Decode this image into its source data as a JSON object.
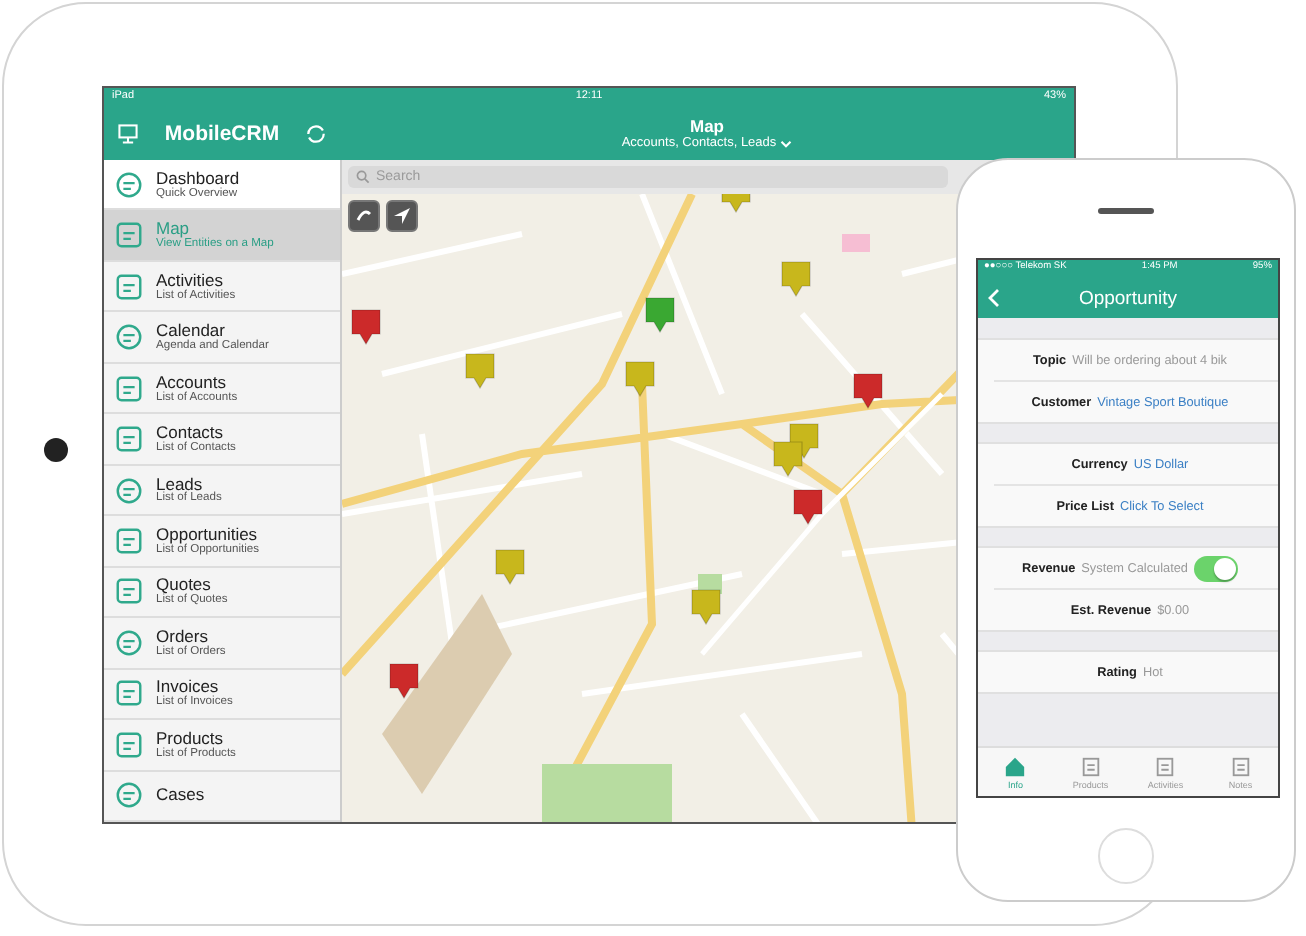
{
  "tablet": {
    "status_bar": {
      "device": "iPad",
      "time": "12:11",
      "battery": "43%"
    },
    "sidebar": {
      "title": "MobileCRM",
      "items": [
        {
          "title": "Dashboard",
          "subtitle": "Quick Overview",
          "selected": false
        },
        {
          "title": "Map",
          "subtitle": "View Entities on a Map",
          "selected": true
        },
        {
          "title": "Activities",
          "subtitle": "List of Activities",
          "selected": false
        },
        {
          "title": "Calendar",
          "subtitle": "Agenda and Calendar",
          "selected": false
        },
        {
          "title": "Accounts",
          "subtitle": "List of Accounts",
          "selected": false
        },
        {
          "title": "Contacts",
          "subtitle": "List of Contacts",
          "selected": false
        },
        {
          "title": "Leads",
          "subtitle": "List of Leads",
          "selected": false
        },
        {
          "title": "Opportunities",
          "subtitle": "List of Opportunities",
          "selected": false
        },
        {
          "title": "Quotes",
          "subtitle": "List of Quotes",
          "selected": false
        },
        {
          "title": "Orders",
          "subtitle": "List of Orders",
          "selected": false
        },
        {
          "title": "Invoices",
          "subtitle": "List of Invoices",
          "selected": false
        },
        {
          "title": "Products",
          "subtitle": "List of Products",
          "selected": false
        },
        {
          "title": "Cases",
          "selected": false
        }
      ]
    },
    "header": {
      "title": "Map",
      "subtitle": "Accounts, Contacts, Leads"
    },
    "search": {
      "placeholder": "Search"
    }
  },
  "phone": {
    "status_bar": {
      "carrier": "●●○○○ Telekom SK",
      "time": "1:45 PM",
      "battery": "95%"
    },
    "title": "Opportunity",
    "sections": [
      [
        {
          "label": "Topic",
          "value": "Will be ordering about 4 bik",
          "kind": "text"
        },
        {
          "label": "Customer",
          "value": "Vintage Sport Boutique",
          "kind": "link"
        }
      ],
      [
        {
          "label": "Currency",
          "value": "US Dollar",
          "kind": "link"
        },
        {
          "label": "Price List",
          "value": "Click To Select",
          "kind": "link"
        }
      ],
      [
        {
          "label": "Revenue",
          "value": "System Calculated",
          "kind": "toggle",
          "on": true
        },
        {
          "label": "Est. Revenue",
          "value": "$0.00",
          "kind": "text"
        }
      ],
      [
        {
          "label": "Rating",
          "value": "Hot",
          "kind": "text"
        }
      ]
    ],
    "tabs": [
      {
        "label": "Info",
        "selected": true
      },
      {
        "label": "Products",
        "selected": false
      },
      {
        "label": "Activities",
        "selected": false
      },
      {
        "label": "Notes",
        "selected": false
      }
    ]
  }
}
